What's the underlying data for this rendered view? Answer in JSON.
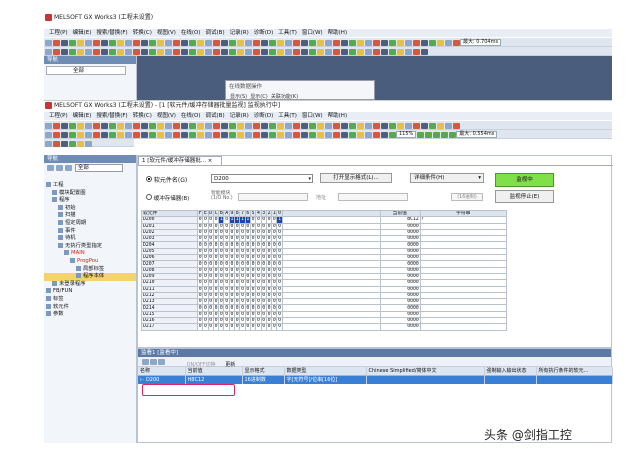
{
  "back_window": {
    "title": "MELSOFT GX Works3 (工程未设置)",
    "menu": [
      "工程(P)",
      "编辑(E)",
      "搜索/替换(F)",
      "转换(C)",
      "视图(V)",
      "在线(O)",
      "调试(B)",
      "记录(R)",
      "诊断(D)",
      "工具(T)",
      "窗口(W)",
      "帮助(H)"
    ],
    "zoom_label": "最大: 0.704ms",
    "nav_header": "导航",
    "nav_filter": "全部",
    "popup": {
      "title": "在线数据操作",
      "items": [
        "显示(S)",
        "显示(C)",
        "关联功能(K)"
      ]
    }
  },
  "front_window": {
    "title": "MELSOFT GX Works3 (工程未设置) - [1 [软元件/缓冲存储器批量监视] 监视执行中]",
    "menu": [
      "工程(P)",
      "编辑(E)",
      "搜索/替换(F)",
      "转换(C)",
      "视图(V)",
      "在线(O)",
      "调试(B)",
      "记录(R)",
      "诊断(D)",
      "工具(T)",
      "窗口(W)",
      "帮助(H)"
    ],
    "zoom_percent": "115%",
    "scan_label": "最大: 0.554ms",
    "nav_header": "导航",
    "nav_filter": "全部",
    "tree": [
      {
        "label": "工程",
        "indent": 0,
        "red": false
      },
      {
        "label": "模块配置图",
        "indent": 1,
        "red": false
      },
      {
        "label": "程序",
        "indent": 1,
        "red": false
      },
      {
        "label": "初始",
        "indent": 2,
        "red": false
      },
      {
        "label": "扫描",
        "indent": 2,
        "red": false
      },
      {
        "label": "恒定周期",
        "indent": 2,
        "red": false
      },
      {
        "label": "事件",
        "indent": 2,
        "red": false
      },
      {
        "label": "待机",
        "indent": 2,
        "red": false
      },
      {
        "label": "无执行类型指定",
        "indent": 2,
        "red": false
      },
      {
        "label": "MAIN",
        "indent": 3,
        "red": true
      },
      {
        "label": "ProgPou",
        "indent": 4,
        "red": true
      },
      {
        "label": "局部标签",
        "indent": 5,
        "red": false
      },
      {
        "label": "程序本体",
        "indent": 5,
        "red": false,
        "selected": true
      },
      {
        "label": "未登录程序",
        "indent": 1,
        "red": false
      },
      {
        "label": "FB/FUN",
        "indent": 0,
        "red": false
      },
      {
        "label": "标签",
        "indent": 0,
        "red": false
      },
      {
        "label": "软元件",
        "indent": 0,
        "red": false
      },
      {
        "label": "参数",
        "indent": 0,
        "red": false
      }
    ],
    "doc_tab": "1 [软元件/缓冲存储器批...",
    "device_name_label": "软元件名(G)",
    "device_value": "D200",
    "buffer_label": "缓冲存储器(B)",
    "unit_label": "智能模块 (1/O No.)",
    "address_label": "地址",
    "buffer_unit": "(16进制)",
    "open_display_format": "打开显示格式(L)...",
    "detail_conditions": "详细条件(H)",
    "monitoring": "监视中",
    "stop_monitor": "监视停止(E)",
    "grid_headers": {
      "device": "软元件",
      "bits": [
        "F",
        "E",
        "D",
        "C",
        "B",
        "A",
        "9",
        "8",
        "7",
        "6",
        "5",
        "4",
        "3",
        "2",
        "1",
        "0"
      ],
      "current": "当前值",
      "string": "字符串"
    },
    "grid_rows": [
      {
        "device": "D200",
        "bits": "0000101111000001",
        "value": "BC12",
        "string": "?"
      },
      {
        "device": "D201",
        "bits": "0000000000000000",
        "value": "0000",
        "string": ""
      },
      {
        "device": "D202",
        "bits": "0000000000000000",
        "value": "0000",
        "string": ""
      },
      {
        "device": "D203",
        "bits": "0000000000000000",
        "value": "0000",
        "string": ""
      },
      {
        "device": "D204",
        "bits": "0000000000000000",
        "value": "0000",
        "string": ""
      },
      {
        "device": "D205",
        "bits": "0000000000000000",
        "value": "0000",
        "string": ""
      },
      {
        "device": "D206",
        "bits": "0000000000000000",
        "value": "0000",
        "string": ""
      },
      {
        "device": "D207",
        "bits": "0000000000000000",
        "value": "0000",
        "string": ""
      },
      {
        "device": "D208",
        "bits": "0000000000000000",
        "value": "0000",
        "string": ""
      },
      {
        "device": "D209",
        "bits": "0000000000000000",
        "value": "0000",
        "string": ""
      },
      {
        "device": "D210",
        "bits": "0000000000000000",
        "value": "0000",
        "string": ""
      },
      {
        "device": "D211",
        "bits": "0000000000000000",
        "value": "0000",
        "string": ""
      },
      {
        "device": "D212",
        "bits": "0000000000000000",
        "value": "0000",
        "string": ""
      },
      {
        "device": "D213",
        "bits": "0000000000000000",
        "value": "0000",
        "string": ""
      },
      {
        "device": "D214",
        "bits": "0000000000000000",
        "value": "0000",
        "string": ""
      },
      {
        "device": "D215",
        "bits": "0000000000000000",
        "value": "0000",
        "string": ""
      },
      {
        "device": "D216",
        "bits": "0000000000000000",
        "value": "0000",
        "string": ""
      },
      {
        "device": "D217",
        "bits": "0000000000000000",
        "value": "0000",
        "string": ""
      }
    ],
    "watch": {
      "title": "监看1 [监看中]",
      "toolbar": [
        "ON/OFF切换",
        "更新"
      ],
      "headers": [
        "名称",
        "当前值",
        "显示格式",
        "数据类型",
        "Chinese Simplified/简体中文",
        "强制输入输出状态",
        "所有执行条件的软元..."
      ],
      "row": {
        "name": "D200",
        "value": "H8C12",
        "format": "16进制数",
        "type": "字[无符号]/位串[16位]"
      }
    }
  },
  "watermark": "头条 @剑指工控",
  "colors": {
    "monitoring_bg": "#7fe04a",
    "nav_header": "#6f8cb4",
    "bit_on": "#1c46b2",
    "selection": "#3a7fd6"
  }
}
